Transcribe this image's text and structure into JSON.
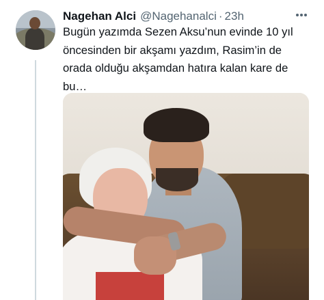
{
  "tweet": {
    "display_name": "Nagehan Alci",
    "handle": "@Nagehanalci",
    "separator": "·",
    "time": "23h",
    "more_icon": "more-icon",
    "text_lines": [
      "Bugün yazımda Sezen Aksu’nun evinde 10 yıl",
      "öncesinden bir akşamı yazdım, Rasim’in de",
      "orada olduğu akşamdan hatıra kalan kare de",
      "bu…"
    ]
  },
  "colors": {
    "text": "#0f1419",
    "secondary": "#536471",
    "thread_line": "#cfd9de",
    "background": "#ffffff"
  }
}
